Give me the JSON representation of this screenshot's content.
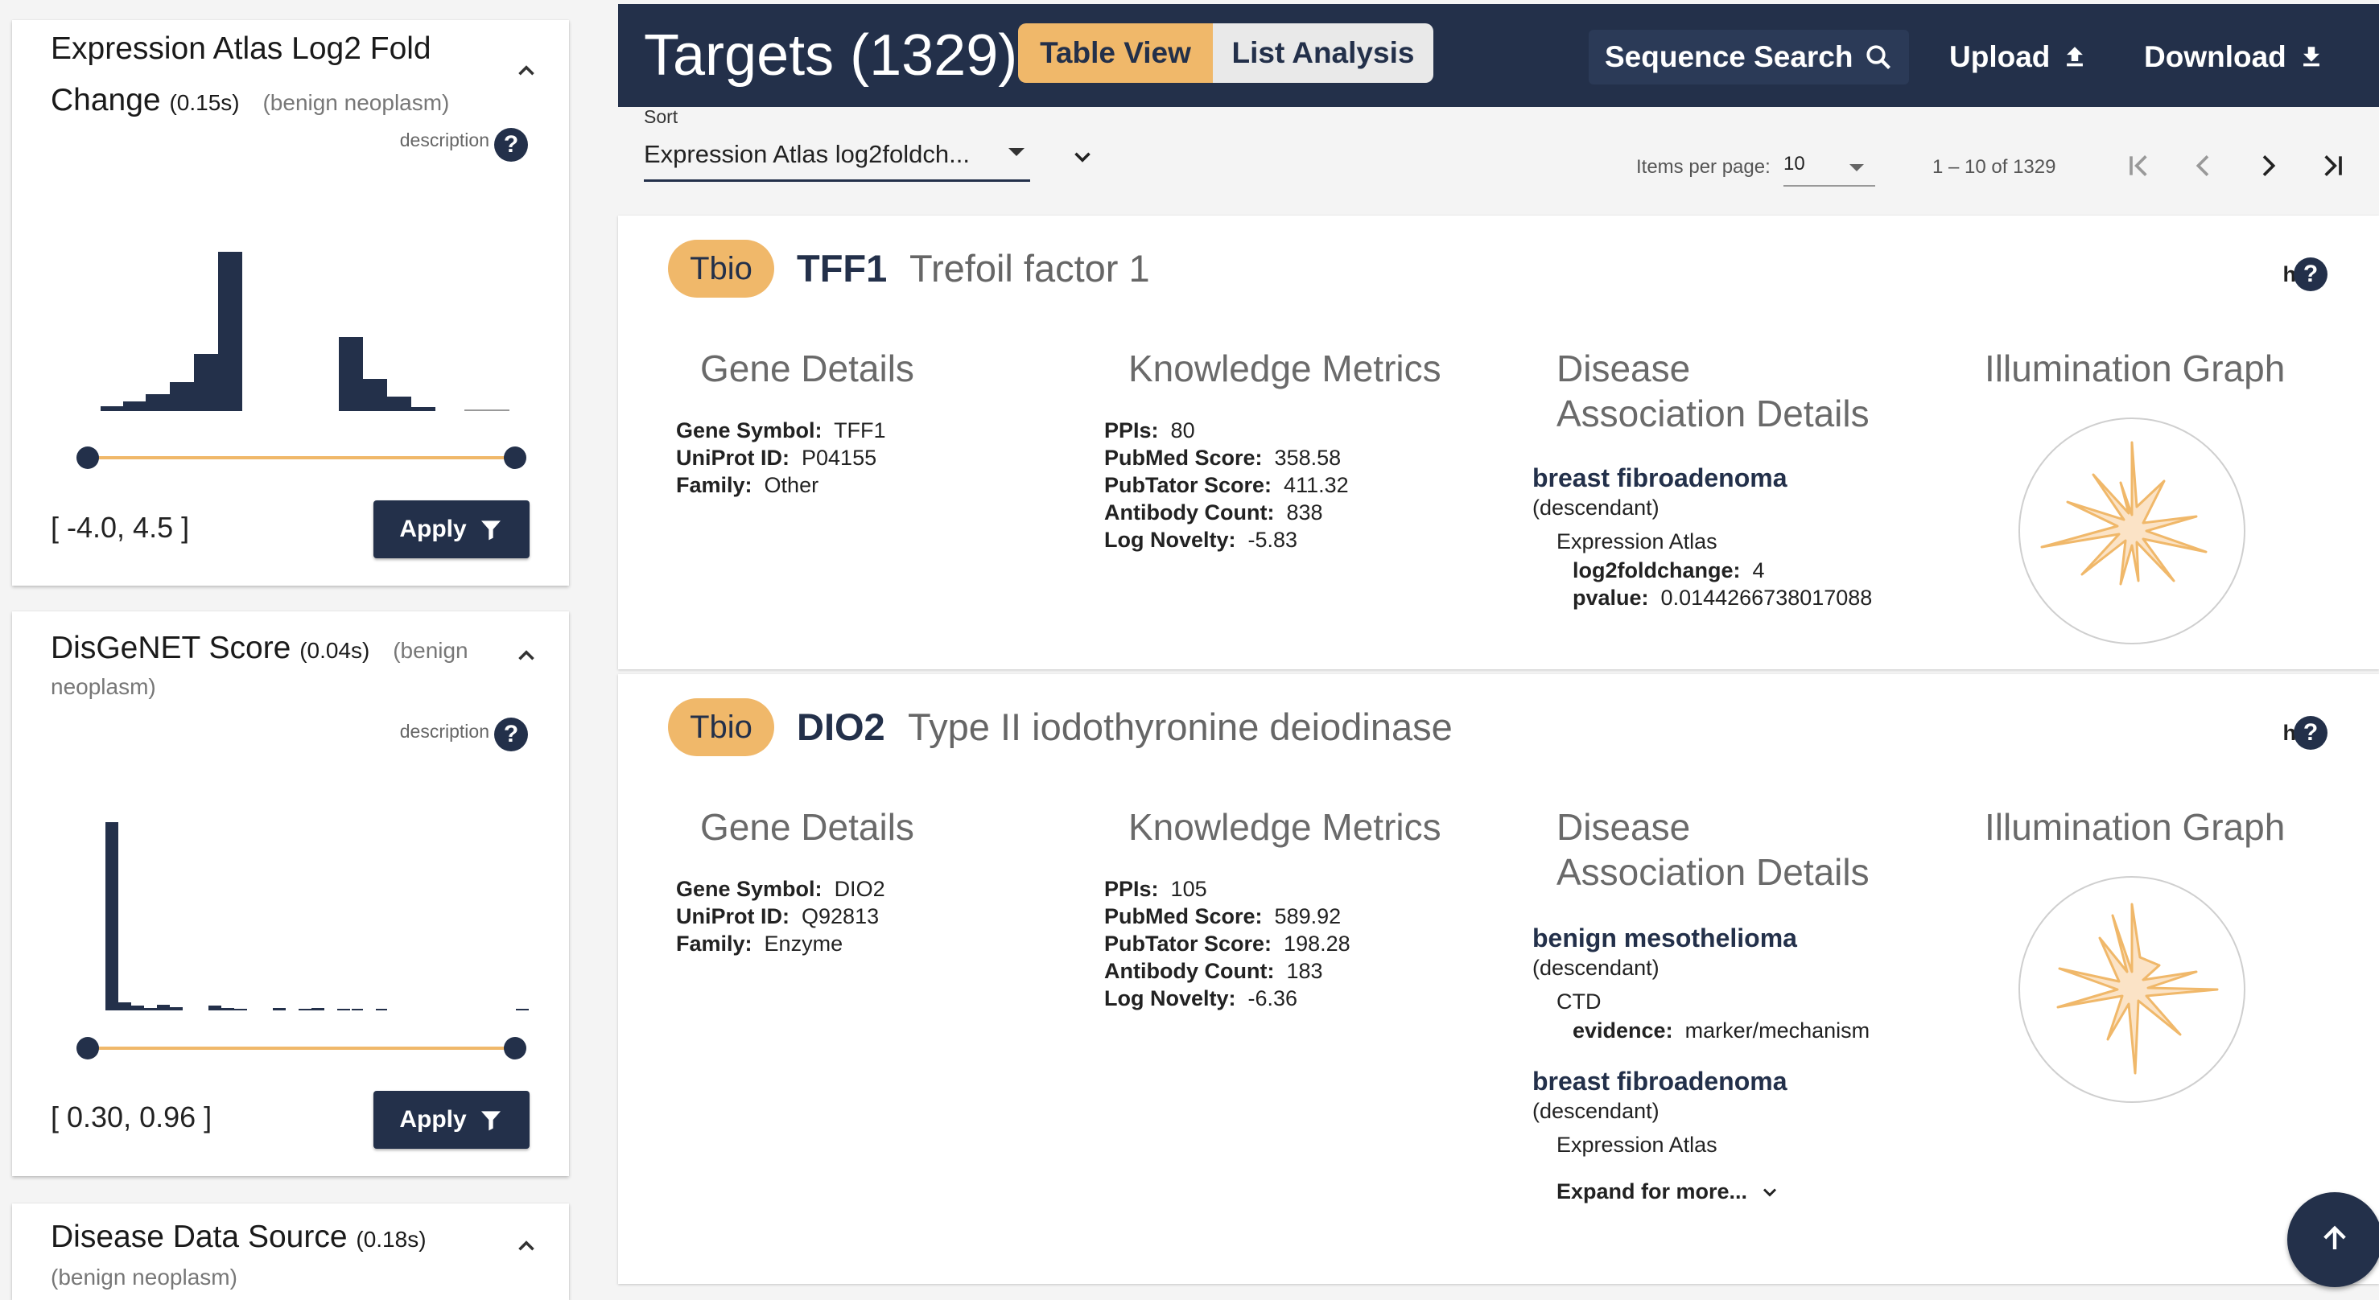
{
  "filters": [
    {
      "title": "Expression Atlas Log2 Fold",
      "title_line2": "Change",
      "time": "(0.15s)",
      "context": "(benign neoplasm)",
      "description_label": "description",
      "range_text": "[ -4.0, 4.5 ]",
      "apply_label": "Apply"
    },
    {
      "title": "DisGeNET Score",
      "time": "(0.04s)",
      "context": "(benign",
      "context_line2": "neoplasm)",
      "description_label": "description",
      "range_text": "[ 0.30, 0.96 ]",
      "apply_label": "Apply"
    },
    {
      "title": "Disease Data Source",
      "time": "(0.18s)",
      "context": "(benign neoplasm)"
    }
  ],
  "header": {
    "title": "Targets (1329)",
    "view_tabs": [
      "Table View",
      "List Analysis"
    ],
    "active_view": "Table View",
    "sequence_search": "Sequence Search",
    "upload": "Upload",
    "download": "Download"
  },
  "sort": {
    "label": "Sort",
    "value": "Expression Atlas log2foldch..."
  },
  "pagination": {
    "items_per_page_label": "Items per page:",
    "items_per_page": "10",
    "range": "1 – 10 of 1329"
  },
  "targets": [
    {
      "tdl": "Tbio",
      "symbol": "TFF1",
      "name": "Trefoil factor 1",
      "help": "help",
      "gene_details_title": "Gene Details",
      "gene_details": [
        {
          "k": "Gene Symbol:",
          "v": "TFF1"
        },
        {
          "k": "UniProt ID:",
          "v": "P04155"
        },
        {
          "k": "Family:",
          "v": "Other"
        }
      ],
      "metrics_title": "Knowledge Metrics",
      "metrics": [
        {
          "k": "PPIs:",
          "v": "80"
        },
        {
          "k": "PubMed Score:",
          "v": "358.58"
        },
        {
          "k": "PubTator Score:",
          "v": "411.32"
        },
        {
          "k": "Antibody Count:",
          "v": "838"
        },
        {
          "k": "Log Novelty:",
          "v": "-5.83"
        }
      ],
      "disease_title_1": "Disease",
      "disease_title_2": "Association Details",
      "diseases": [
        {
          "name": "breast fibroadenoma",
          "relation": "(descendant)",
          "source": "Expression Atlas",
          "fields": [
            {
              "k": "log2foldchange:",
              "v": "4"
            },
            {
              "k": "pvalue:",
              "v": "0.0144266738017088"
            }
          ]
        }
      ],
      "graph_title": "Illumination Graph"
    },
    {
      "tdl": "Tbio",
      "symbol": "DIO2",
      "name": "Type II iodothyronine deiodinase",
      "help": "help",
      "gene_details_title": "Gene Details",
      "gene_details": [
        {
          "k": "Gene Symbol:",
          "v": "DIO2"
        },
        {
          "k": "UniProt ID:",
          "v": "Q92813"
        },
        {
          "k": "Family:",
          "v": "Enzyme"
        }
      ],
      "metrics_title": "Knowledge Metrics",
      "metrics": [
        {
          "k": "PPIs:",
          "v": "105"
        },
        {
          "k": "PubMed Score:",
          "v": "589.92"
        },
        {
          "k": "PubTator Score:",
          "v": "198.28"
        },
        {
          "k": "Antibody Count:",
          "v": "183"
        },
        {
          "k": "Log Novelty:",
          "v": "-6.36"
        }
      ],
      "disease_title_1": "Disease",
      "disease_title_2": "Association Details",
      "diseases": [
        {
          "name": "benign mesothelioma",
          "relation": "(descendant)",
          "source": "CTD",
          "fields": [
            {
              "k": "evidence:",
              "v": "marker/mechanism"
            }
          ]
        },
        {
          "name": "breast fibroadenoma",
          "relation": "(descendant)",
          "source": "Expression Atlas",
          "fields": []
        }
      ],
      "expand_label": "Expand for more...",
      "graph_title": "Illumination Graph"
    }
  ],
  "colors": {
    "navy": "#23304a",
    "orange": "#f0b86a"
  }
}
